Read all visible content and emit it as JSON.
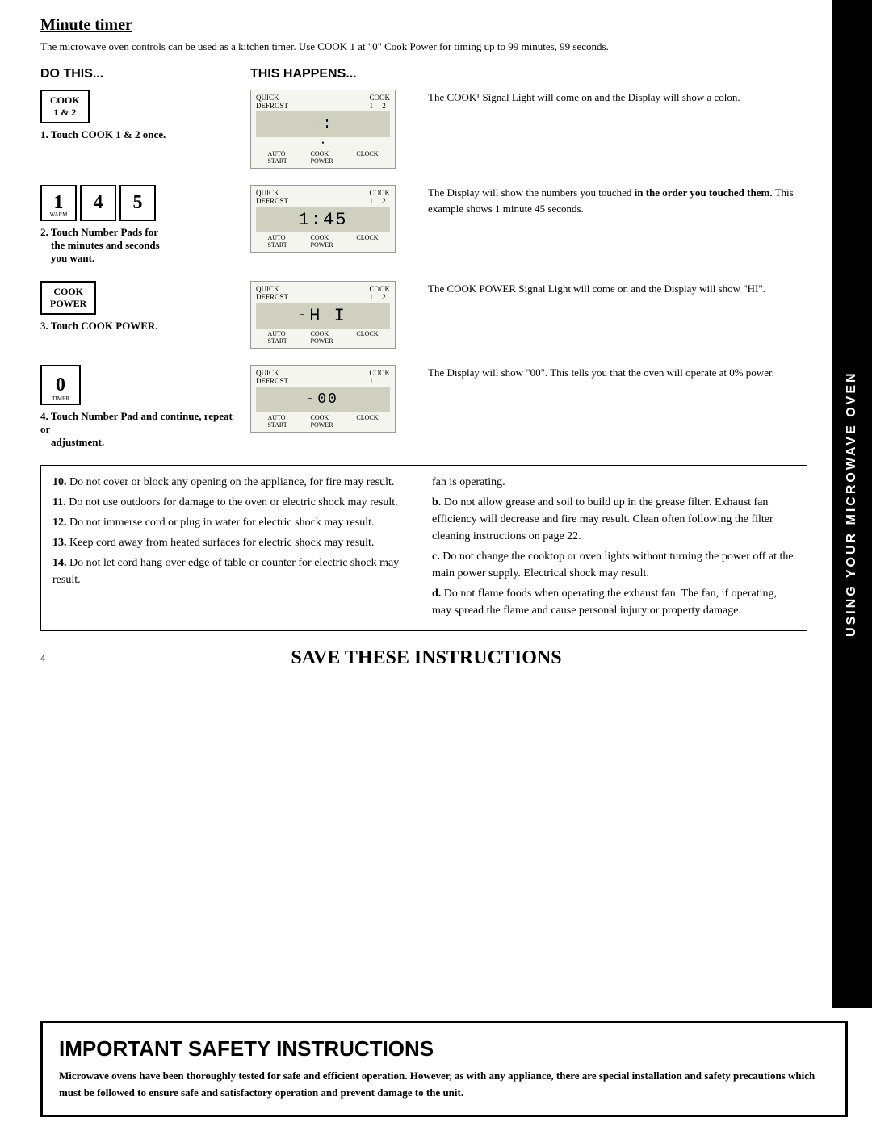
{
  "sidebar": {
    "text": "USING YOUR MICROWAVE OVEN"
  },
  "minuteTimer": {
    "title": "Minute timer",
    "intro": "The microwave oven controls can be used as a kitchen timer. Use COOK 1 at \"0\" Cook Power for timing up to 99 minutes, 99 seconds.",
    "doThisHeader": "DO THIS...",
    "happensHeader": "THIS HAPPENS...",
    "steps": [
      {
        "number": "1",
        "doLabel": "Touch COOK 1 & 2 once.",
        "buttonLabel": "COOK\n1 & 2",
        "displayScreen": ":",
        "displayType": "colon",
        "description": "The COOK¹ Signal Light will come on and the Display will show a colon."
      },
      {
        "number": "2",
        "doLabel": "Touch Number Pads for the minutes and seconds you want.",
        "nums": [
          "1",
          "4",
          "5"
        ],
        "numSub": [
          "WARM",
          "",
          ""
        ],
        "displayScreen": "1:45",
        "description": "The Display will show the numbers you touched in the order you touched them. This example shows 1 minute 45 seconds."
      },
      {
        "number": "3",
        "doLabel": "Touch COOK POWER.",
        "buttonLabel": "COOK\nPOWER",
        "displayScreen": "H I",
        "description": "The COOK POWER Signal Light will come on and the Display will show \"HI\"."
      },
      {
        "number": "4",
        "doLabel": "Touch Number Pad and continue, repeat or adjustment.",
        "buttonNum": "0",
        "buttonSub": "TIMER",
        "displayScreen": "00",
        "description": "The Display will show \"00\". This tells you that the oven will operate at 0% power."
      }
    ]
  },
  "bottomSection": {
    "leftItems": [
      {
        "num": "10",
        "text": "Do not cover or block any opening on the appliance, for fire may result."
      },
      {
        "num": "11",
        "text": "Do not use outdoors for damage to the oven or electric shock may result."
      },
      {
        "num": "12",
        "text": "Do not immerse cord or plug in water for electric shock may result."
      },
      {
        "num": "13",
        "text": "Keep cord away from heated surfaces for electric shock may result."
      },
      {
        "num": "14",
        "text": "Do not let cord hang over edge of table or counter for electric shock may result."
      }
    ],
    "rightItems": [
      {
        "letter": "fan is operating.",
        "text": ""
      },
      {
        "letter": "b.",
        "text": "Do not allow grease and soil to build up in the grease filter. Exhaust fan efficiency will decrease and fire may result. Clean often following the filter cleaning instructions on page 22."
      },
      {
        "letter": "c.",
        "text": "Do not change the cooktop or oven lights without turning the power off at the main power supply. Electrical shock may result."
      },
      {
        "letter": "d.",
        "text": "Do not flame foods when operating the exhaust fan. The fan, if operating, may spread the flame and cause personal injury or property damage."
      }
    ],
    "saveInstructions": "SAVE THESE INSTRUCTIONS",
    "pageNum": "4"
  },
  "safetyBox": {
    "title": "IMPORTANT SAFETY INSTRUCTIONS",
    "body": "Microwave ovens have been thoroughly tested for safe and efficient operation. However, as with any appliance, there are special installation and safety precautions which must be followed to ensure safe and satisfactory operation and prevent damage to the unit."
  }
}
